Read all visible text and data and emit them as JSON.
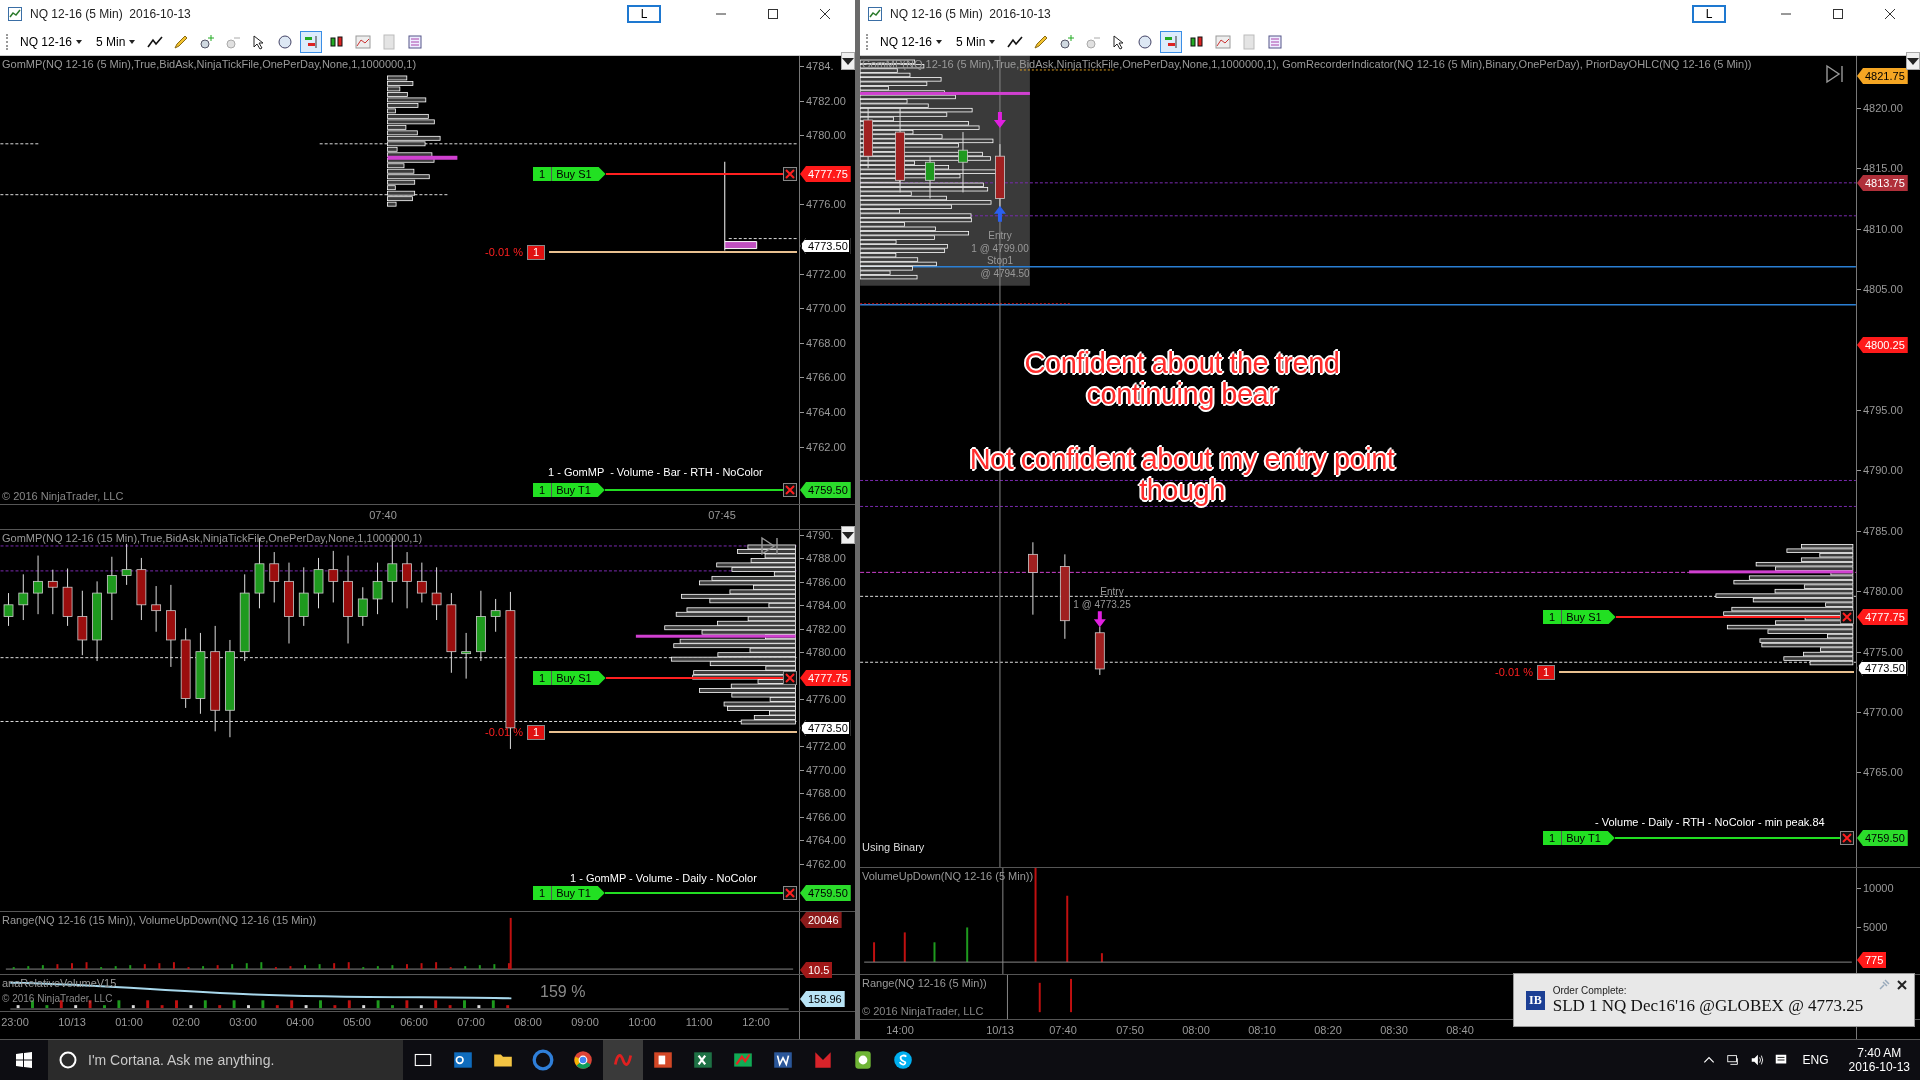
{
  "windows": [
    {
      "title": "NQ 12-16 (5 Min)  2016-10-13",
      "link_button": "L",
      "toolbar": {
        "instrument": "NQ 12-16",
        "interval": "5 Min"
      },
      "panes": [
        {
          "kind": "price",
          "indicator_label": "GomMP(NQ 12-16 (5 Min),True,BidAsk,NinjaTickFile,OnePerDay,None,1,1000000,1)",
          "price_ticks": [
            "4784.",
            "4782.00",
            "4780.00",
            "4776.00",
            "4772.00",
            "4770.00",
            "4768.00",
            "4766.00",
            "4764.00",
            "4762.00"
          ],
          "price_labels": [
            {
              "text": "4777.75",
              "kind": "stop"
            },
            {
              "text": "4773.50",
              "kind": "last"
            },
            {
              "text": "4759.50",
              "kind": "target"
            }
          ],
          "orders": [
            {
              "qty": "1",
              "name": "Buy S1",
              "kind": "stop"
            },
            {
              "qty": "1",
              "name": "Buy T1",
              "kind": "target"
            }
          ],
          "position": {
            "pnl": "-0.01 %",
            "qty": "1"
          },
          "profile_label": "1 - GomMP  - Volume - Bar - RTH - NoColor",
          "copyright": "© 2016 NinjaTrader, LLC"
        },
        {
          "kind": "time_axis",
          "ticks": [
            "07:40",
            "07:45"
          ]
        },
        {
          "kind": "price",
          "indicator_label": "GomMP(NQ 12-16 (15 Min),True,BidAsk,NinjaTickFile,OnePerDay,None,1,1000000,1)",
          "price_ticks": [
            "4790.",
            "4788.00",
            "4786.00",
            "4784.00",
            "4782.00",
            "4780.00",
            "4776.00",
            "4772.00",
            "4770.00",
            "4768.00",
            "4766.00",
            "4764.00",
            "4762.00"
          ],
          "price_labels": [
            {
              "text": "4777.75",
              "kind": "stop"
            },
            {
              "text": "4773.50",
              "kind": "last"
            },
            {
              "text": "4759.50",
              "kind": "target"
            }
          ],
          "orders": [
            {
              "qty": "1",
              "name": "Buy S1",
              "kind": "stop"
            },
            {
              "qty": "1",
              "name": "Buy T1",
              "kind": "target"
            }
          ],
          "position": {
            "pnl": "-0.01 %",
            "qty": "1"
          },
          "profile_label": "1 - GomMP - Volume - Daily - NoColor"
        },
        {
          "kind": "volume",
          "indicator_label": "Range(NQ 12-16 (15 Min)), VolumeUpDown(NQ 12-16 (15 Min))",
          "price_labels": [
            {
              "text": "20046",
              "kind": "volume"
            },
            {
              "text": "10.5",
              "kind": "range"
            }
          ]
        },
        {
          "kind": "relative_volume",
          "indicator_label": "anaRelativeVolumeV15",
          "copyright": "© 2016 NinjaTrader, LLC",
          "reading": "159 %",
          "price_labels": [
            {
              "text": "158.96",
              "kind": "relvol"
            }
          ]
        },
        {
          "kind": "time_axis",
          "ticks": [
            "23:00",
            "10/13",
            "01:00",
            "02:00",
            "03:00",
            "04:00",
            "05:00",
            "06:00",
            "07:00",
            "08:00",
            "09:00",
            "10:00",
            "11:00",
            "12:00"
          ]
        }
      ]
    },
    {
      "title": "NQ 12-16 (5 Min)  2016-10-13",
      "link_button": "L",
      "toolbar": {
        "instrument": "NQ 12-16",
        "interval": "5 Min"
      },
      "panes": [
        {
          "kind": "price",
          "indicator_label": "GomMP(NQ 12-16 (5 Min),True,BidAsk,NinjaTickFile,OnePerDay,None,1,1000000,1), GomRecorderIndicator(NQ 12-16 (5 Min),Binary,OnePerDay), PriorDayOHLC(NQ 12-16 (5 Min))",
          "price_ticks": [
            "4820.00",
            "4815.00",
            "4810.00",
            "4805.00",
            "4795.00",
            "4790.00",
            "4785.00",
            "4780.00",
            "4775.00",
            "4770.00",
            "4765.00"
          ],
          "price_labels": [
            {
              "text": "4821.75",
              "kind": "high"
            },
            {
              "text": "4813.75",
              "kind": "level"
            },
            {
              "text": "4800.25",
              "kind": "stop"
            },
            {
              "text": "4777.75",
              "kind": "stop"
            },
            {
              "text": "4773.50",
              "kind": "last"
            },
            {
              "text": "4759.50",
              "kind": "target"
            }
          ],
          "orders": [
            {
              "qty": "1",
              "name": "Buy S1",
              "kind": "stop"
            },
            {
              "qty": "1",
              "name": "Buy T1",
              "kind": "target"
            }
          ],
          "position": {
            "pnl": "-0.01 %",
            "qty": "1"
          },
          "profile_label": "- Volume - Daily - RTH - NoColor - min peak.84",
          "status": "Using Binary",
          "trade_notes": [
            "Entry",
            "1 @ 4799.00",
            "Stop1",
            "@ 4794.50",
            "Entry",
            "1 @ 4773.25"
          ],
          "notes": [
            "Confident about the trend continuing bear",
            "Not confident about my entry point though"
          ]
        },
        {
          "kind": "volume",
          "indicator_label": "VolumeUpDown(NQ 12-16 (5 Min))",
          "price_ticks": [
            "10000",
            "5000"
          ],
          "price_labels": [
            {
              "text": "775",
              "kind": "stop"
            }
          ]
        },
        {
          "kind": "range",
          "indicator_label": "Range(NQ 12-16 (5 Min))",
          "copyright": "© 2016 NinjaTrader, LLC"
        },
        {
          "kind": "time_axis",
          "ticks": [
            "14:00",
            "10/13",
            "07:40",
            "07:50",
            "08:00",
            "08:10",
            "08:20",
            "08:30",
            "08:40"
          ]
        }
      ]
    }
  ],
  "toast": {
    "logo": "IB",
    "title": "Order Complete:",
    "message": "SLD 1 NQ Dec16'16 @GLOBEX @ 4773.25"
  },
  "taskbar": {
    "search_placeholder": "I'm Cortana. Ask me anything.",
    "language": "ENG",
    "time": "7:40 AM",
    "date": "2016-10-13"
  }
}
